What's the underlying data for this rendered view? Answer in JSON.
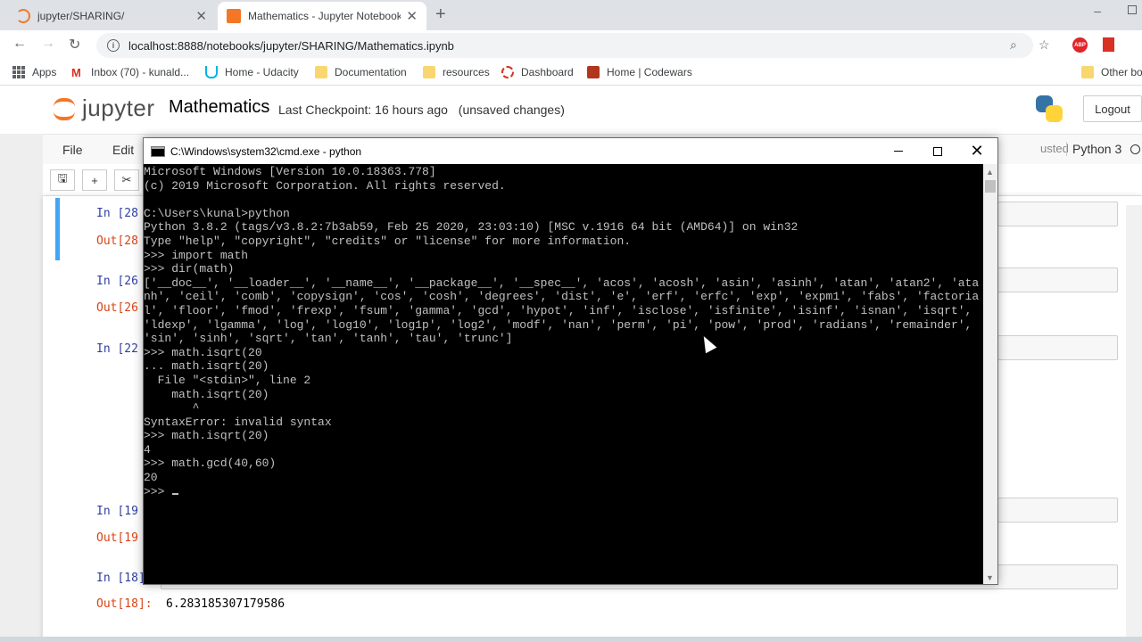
{
  "browser": {
    "tabs": [
      {
        "title": "jupyter/SHARING/",
        "close": "✕"
      },
      {
        "title": "Mathematics - Jupyter Notebook",
        "close": "✕"
      }
    ],
    "new_tab": "+",
    "url": "localhost:8888/notebooks/jupyter/SHARING/Mathematics.ipynb",
    "nav": {
      "back": "←",
      "forward": "→",
      "reload": "↻"
    },
    "omni_icons": {
      "zoom": "⌕",
      "star": "☆"
    },
    "ext_abp": "ABP",
    "bookmarks": [
      {
        "label": "Apps",
        "icon": "apps-icon"
      },
      {
        "label": "Inbox (70) - kunald...",
        "icon": "gmail-icon"
      },
      {
        "label": "Home - Udacity",
        "icon": "udacity-icon"
      },
      {
        "label": "Documentation",
        "icon": "folder-icon"
      },
      {
        "label": "resources",
        "icon": "folder-icon"
      },
      {
        "label": "Dashboard",
        "icon": "dashboard-icon"
      },
      {
        "label": "Home | Codewars",
        "icon": "codewars-icon"
      },
      {
        "label": "Other bo",
        "icon": "folder-icon"
      }
    ],
    "gmail_glyph": "M",
    "window_min": "–"
  },
  "jupyter": {
    "logo_text": "jupyter",
    "notebook_title": "Mathematics",
    "checkpoint": "Last Checkpoint: 16 hours ago",
    "unsaved": "(unsaved changes)",
    "logout": "Logout",
    "menu": [
      "File",
      "Edit"
    ],
    "trusted": "usted",
    "kernel": "Python 3",
    "toolbar": {
      "save": "🖫",
      "add": "+",
      "cut": "✂"
    },
    "cells": [
      {
        "in": "In [28",
        "out": "Out[28"
      },
      {
        "in": "In [26",
        "out": "Out[26"
      },
      {
        "in": "In [22",
        "out": ""
      },
      {
        "in": "In [19",
        "out": "Out[19"
      },
      {
        "in": "In [18]",
        "out": "Out[18]:",
        "result": "6.283185307179586"
      }
    ]
  },
  "cmd": {
    "title": "C:\\Windows\\system32\\cmd.exe - python",
    "controls": {
      "close": "✕"
    },
    "lines": [
      "Microsoft Windows [Version 10.0.18363.778]",
      "(c) 2019 Microsoft Corporation. All rights reserved.",
      "",
      "C:\\Users\\kunal>python",
      "Python 3.8.2 (tags/v3.8.2:7b3ab59, Feb 25 2020, 23:03:10) [MSC v.1916 64 bit (AMD64)] on win32",
      "Type \"help\", \"copyright\", \"credits\" or \"license\" for more information.",
      ">>> import math",
      ">>> dir(math)",
      "['__doc__', '__loader__', '__name__', '__package__', '__spec__', 'acos', 'acosh', 'asin', 'asinh', 'atan', 'atan2', 'ata",
      "nh', 'ceil', 'comb', 'copysign', 'cos', 'cosh', 'degrees', 'dist', 'e', 'erf', 'erfc', 'exp', 'expm1', 'fabs', 'factoria",
      "l', 'floor', 'fmod', 'frexp', 'fsum', 'gamma', 'gcd', 'hypot', 'inf', 'isclose', 'isfinite', 'isinf', 'isnan', 'isqrt',",
      "'ldexp', 'lgamma', 'log', 'log10', 'log1p', 'log2', 'modf', 'nan', 'perm', 'pi', 'pow', 'prod', 'radians', 'remainder',",
      "'sin', 'sinh', 'sqrt', 'tan', 'tanh', 'tau', 'trunc']",
      ">>> math.isqrt(20",
      "... math.isqrt(20)",
      "  File \"<stdin>\", line 2",
      "    math.isqrt(20)",
      "       ^",
      "SyntaxError: invalid syntax",
      ">>> math.isqrt(20)",
      "4",
      ">>> math.gcd(40,60)",
      "20",
      ">>> "
    ]
  }
}
